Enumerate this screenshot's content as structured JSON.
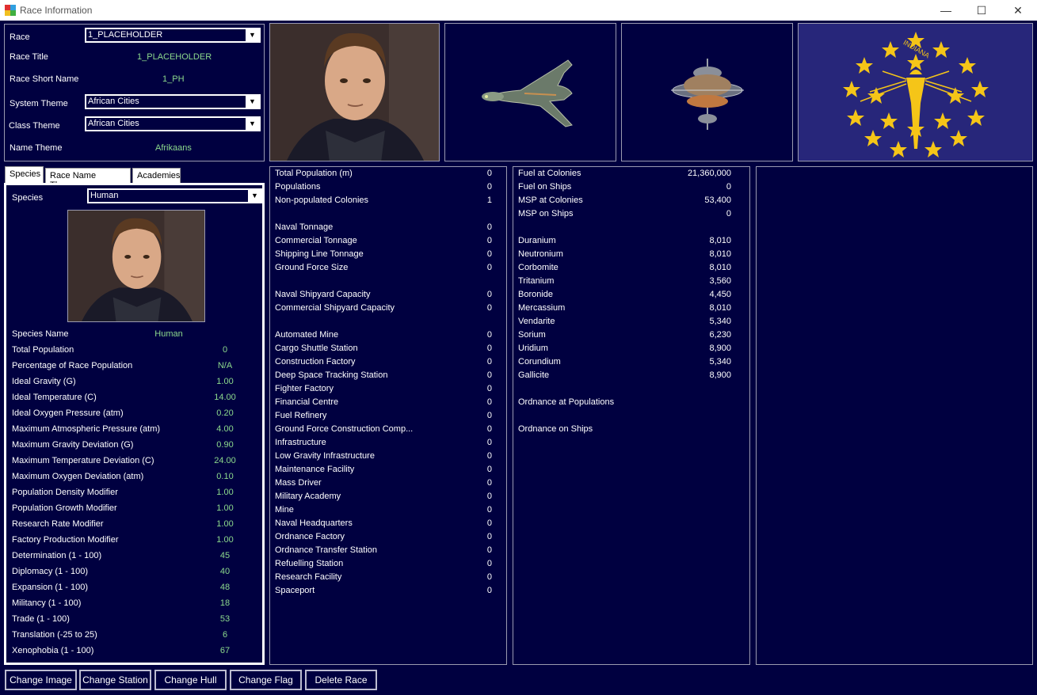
{
  "window": {
    "title": "Race Information",
    "minimize": "—",
    "maximize": "☐",
    "close": "✕"
  },
  "race_panel": {
    "race_label": "Race",
    "race_value": "1_PLACEHOLDER",
    "race_title_label": "Race Title",
    "race_title_value": "1_PLACEHOLDER",
    "short_name_label": "Race Short Name",
    "short_name_value": "1_PH",
    "system_theme_label": "System Theme",
    "system_theme_value": "African Cities",
    "class_theme_label": "Class Theme",
    "class_theme_value": "African Cities",
    "name_theme_label": "Name Theme",
    "name_theme_value": "Afrikaans"
  },
  "images": {
    "portrait": "race-portrait",
    "hull": "ship-hull-image",
    "station": "space-station-image",
    "flag": "indiana-flag",
    "flag_text": "INDIANA"
  },
  "tabs": [
    "Species",
    "Race Name Themes",
    "Academies"
  ],
  "species": {
    "species_label": "Species",
    "species_value": "Human",
    "rows": [
      {
        "label": "Species Name",
        "value": "Human"
      },
      {
        "label": "Total Population",
        "value": "0"
      },
      {
        "label": "Percentage of Race Population",
        "value": "N/A"
      },
      {
        "label": "Ideal Gravity (G)",
        "value": "1.00"
      },
      {
        "label": "Ideal Temperature (C)",
        "value": "14.00"
      },
      {
        "label": "Ideal Oxygen Pressure (atm)",
        "value": "0.20"
      },
      {
        "label": "Maximum Atmospheric Pressure (atm)",
        "value": "4.00"
      },
      {
        "label": "Maximum Gravity Deviation (G)",
        "value": "0.90"
      },
      {
        "label": "Maximum Temperature Deviation (C)",
        "value": "24.00"
      },
      {
        "label": "Maximum Oxygen Deviation (atm)",
        "value": "0.10"
      },
      {
        "label": "Population Density Modifier",
        "value": "1.00"
      },
      {
        "label": "Population Growth Modifier",
        "value": "1.00"
      },
      {
        "label": "Research Rate Modifier",
        "value": "1.00"
      },
      {
        "label": "Factory Production Modifier",
        "value": "1.00"
      },
      {
        "label": "Determination (1 - 100)",
        "value": "45"
      },
      {
        "label": "Diplomacy (1 - 100)",
        "value": "40"
      },
      {
        "label": "Expansion (1 - 100)",
        "value": "48"
      },
      {
        "label": "Militancy (1 - 100)",
        "value": "18"
      },
      {
        "label": "Trade (1 - 100)",
        "value": "53"
      },
      {
        "label": "Translation (-25 to 25)",
        "value": "6"
      },
      {
        "label": "Xenophobia (1 - 100)",
        "value": "67"
      }
    ]
  },
  "stats_column": [
    {
      "label": "Total Population (m)",
      "value": "0"
    },
    {
      "label": "Populations",
      "value": "0"
    },
    {
      "label": "Non-populated Colonies",
      "value": "1"
    },
    {
      "label": "",
      "value": ""
    },
    {
      "label": "Naval Tonnage",
      "value": "0"
    },
    {
      "label": "Commercial Tonnage",
      "value": "0"
    },
    {
      "label": "Shipping Line Tonnage",
      "value": "0"
    },
    {
      "label": "Ground Force Size",
      "value": "0"
    },
    {
      "label": "",
      "value": ""
    },
    {
      "label": "Naval Shipyard Capacity",
      "value": "0"
    },
    {
      "label": "Commercial Shipyard Capacity",
      "value": "0"
    },
    {
      "label": "",
      "value": ""
    },
    {
      "label": "Automated Mine",
      "value": "0"
    },
    {
      "label": "Cargo Shuttle Station",
      "value": "0"
    },
    {
      "label": "Construction Factory",
      "value": "0"
    },
    {
      "label": "Deep Space Tracking Station",
      "value": "0"
    },
    {
      "label": "Fighter Factory",
      "value": "0"
    },
    {
      "label": "Financial Centre",
      "value": "0"
    },
    {
      "label": "Fuel Refinery",
      "value": "0"
    },
    {
      "label": "Ground Force Construction Comp...",
      "value": "0"
    },
    {
      "label": "Infrastructure",
      "value": "0"
    },
    {
      "label": "Low Gravity Infrastructure",
      "value": "0"
    },
    {
      "label": "Maintenance Facility",
      "value": "0"
    },
    {
      "label": "Mass Driver",
      "value": "0"
    },
    {
      "label": "Military Academy",
      "value": "0"
    },
    {
      "label": "Mine",
      "value": "0"
    },
    {
      "label": "Naval Headquarters",
      "value": "0"
    },
    {
      "label": "Ordnance Factory",
      "value": "0"
    },
    {
      "label": "Ordnance Transfer Station",
      "value": "0"
    },
    {
      "label": "Refuelling Station",
      "value": "0"
    },
    {
      "label": "Research Facility",
      "value": "0"
    },
    {
      "label": "Spaceport",
      "value": "0"
    }
  ],
  "resources_column": [
    {
      "label": "Fuel at Colonies",
      "value": "21,360,000"
    },
    {
      "label": "Fuel on Ships",
      "value": "0"
    },
    {
      "label": "MSP at Colonies",
      "value": "53,400"
    },
    {
      "label": "MSP on Ships",
      "value": "0"
    },
    {
      "label": "",
      "value": ""
    },
    {
      "label": "Duranium",
      "value": "8,010"
    },
    {
      "label": "Neutronium",
      "value": "8,010"
    },
    {
      "label": "Corbomite",
      "value": "8,010"
    },
    {
      "label": "Tritanium",
      "value": "3,560"
    },
    {
      "label": "Boronide",
      "value": "4,450"
    },
    {
      "label": "Mercassium",
      "value": "8,010"
    },
    {
      "label": "Vendarite",
      "value": "5,340"
    },
    {
      "label": "Sorium",
      "value": "6,230"
    },
    {
      "label": "Uridium",
      "value": "8,900"
    },
    {
      "label": "Corundium",
      "value": "5,340"
    },
    {
      "label": "Gallicite",
      "value": "8,900"
    },
    {
      "label": "",
      "value": ""
    },
    {
      "label": "Ordnance at Populations",
      "value": ""
    },
    {
      "label": "",
      "value": ""
    },
    {
      "label": "Ordnance on Ships",
      "value": ""
    }
  ],
  "buttons": [
    "Change Image",
    "Change Station",
    "Change Hull",
    "Change Flag",
    "Delete Race"
  ],
  "colors": {
    "background": "#000040",
    "value_text": "#8cd98c",
    "border": "#9a9ab0",
    "flag_gold": "#f5c518"
  }
}
